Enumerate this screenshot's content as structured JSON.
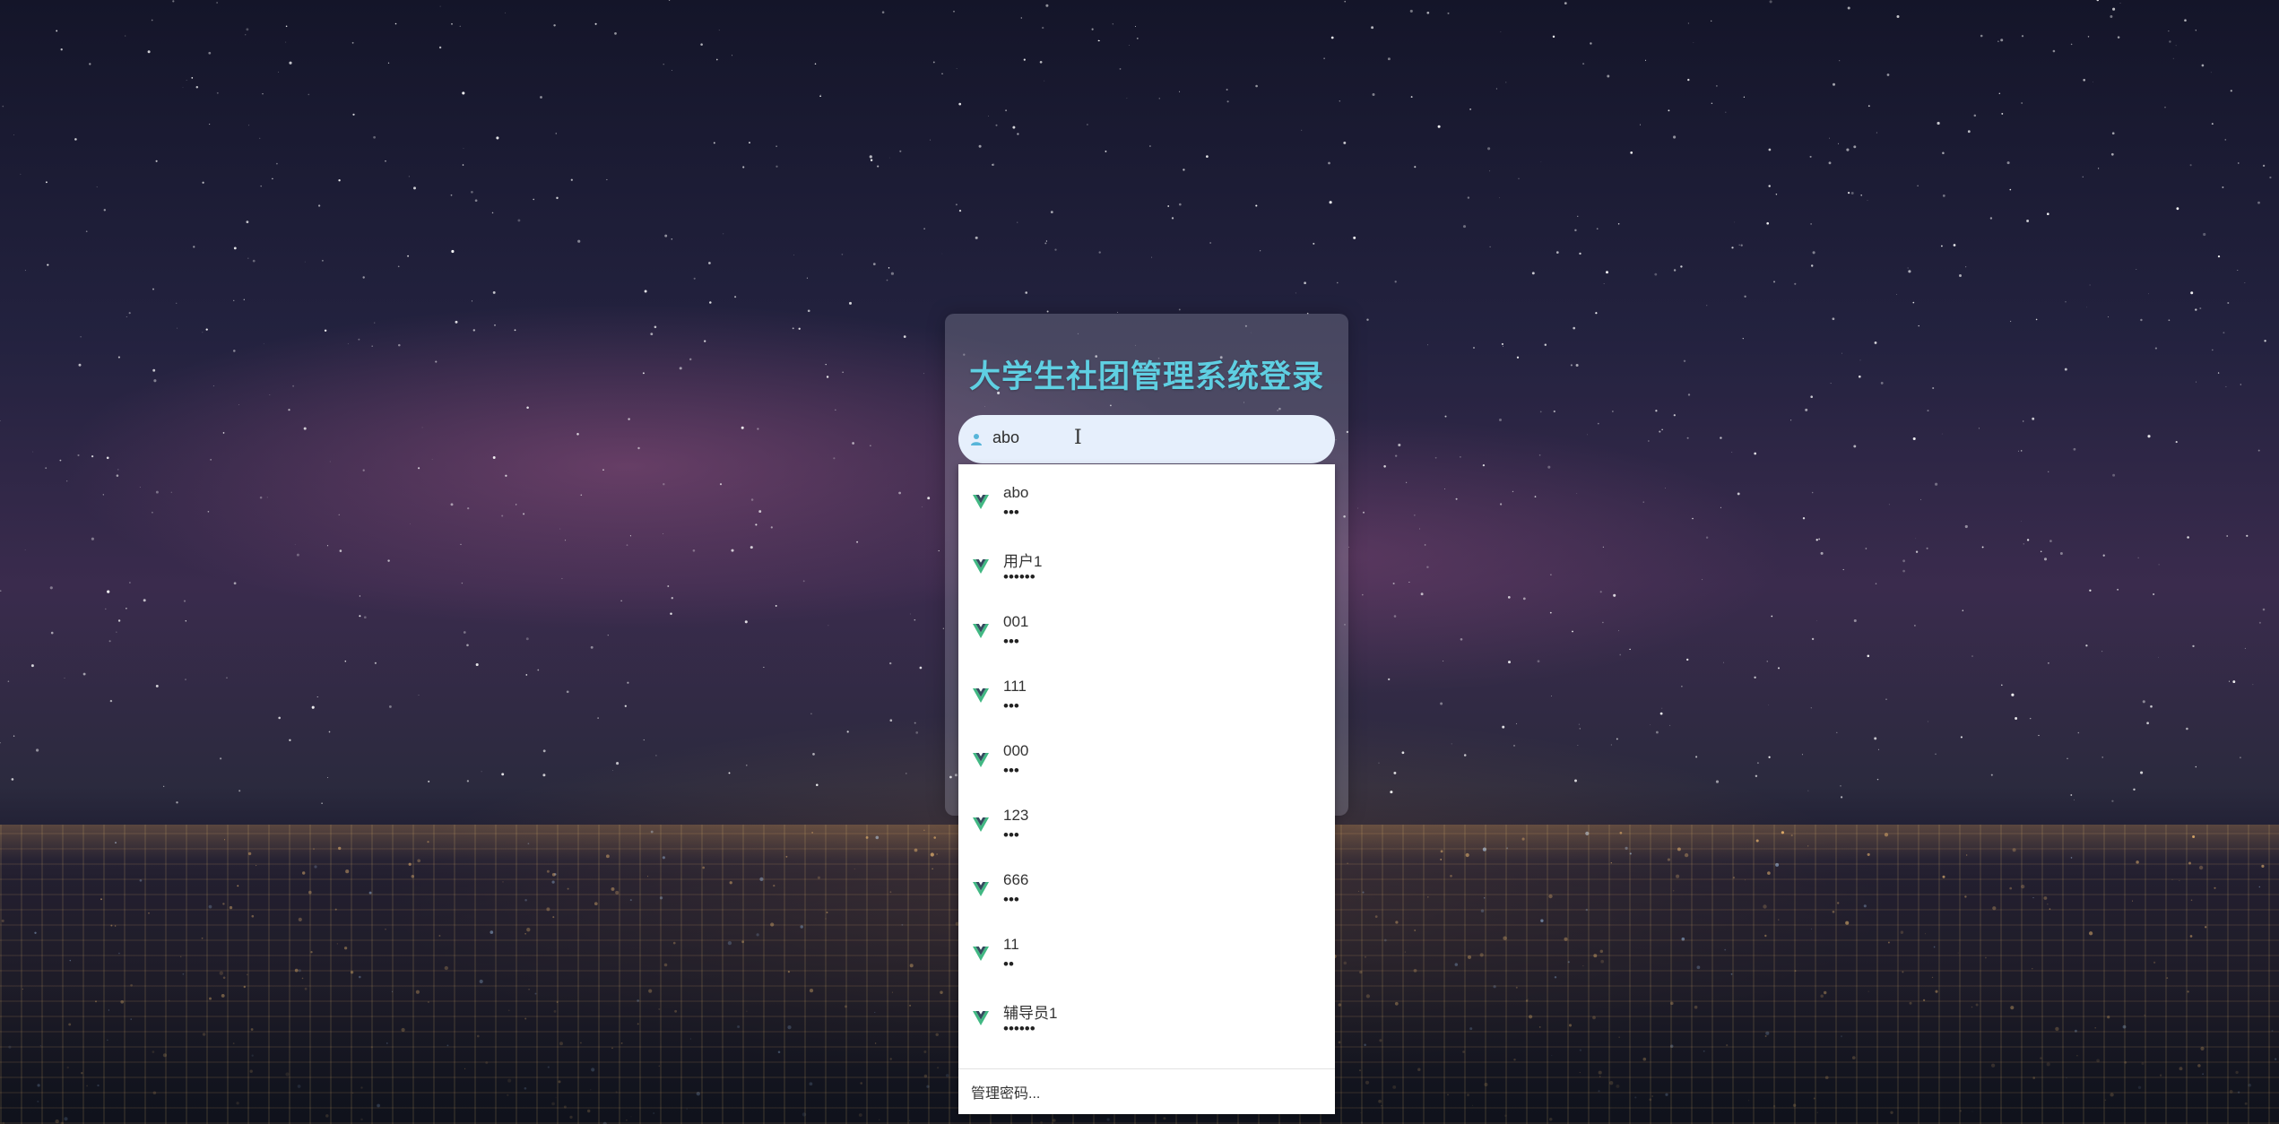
{
  "login": {
    "title": "大学生社团管理系统登录",
    "username_value": "abo",
    "title_color": "#5fcfe2",
    "field_bg": "#e6effc"
  },
  "autocomplete": {
    "items": [
      {
        "name": "abo",
        "password_mask": "•••"
      },
      {
        "name": "用户1",
        "password_mask": "••••••"
      },
      {
        "name": "001",
        "password_mask": "•••"
      },
      {
        "name": "111",
        "password_mask": "•••"
      },
      {
        "name": "000",
        "password_mask": "•••"
      },
      {
        "name": "123",
        "password_mask": "•••"
      },
      {
        "name": "666",
        "password_mask": "•••"
      },
      {
        "name": "11",
        "password_mask": "••"
      },
      {
        "name": "辅导员1",
        "password_mask": "••••••"
      }
    ],
    "manage_label": "管理密码...",
    "item_icon": "vue-logo-icon"
  }
}
